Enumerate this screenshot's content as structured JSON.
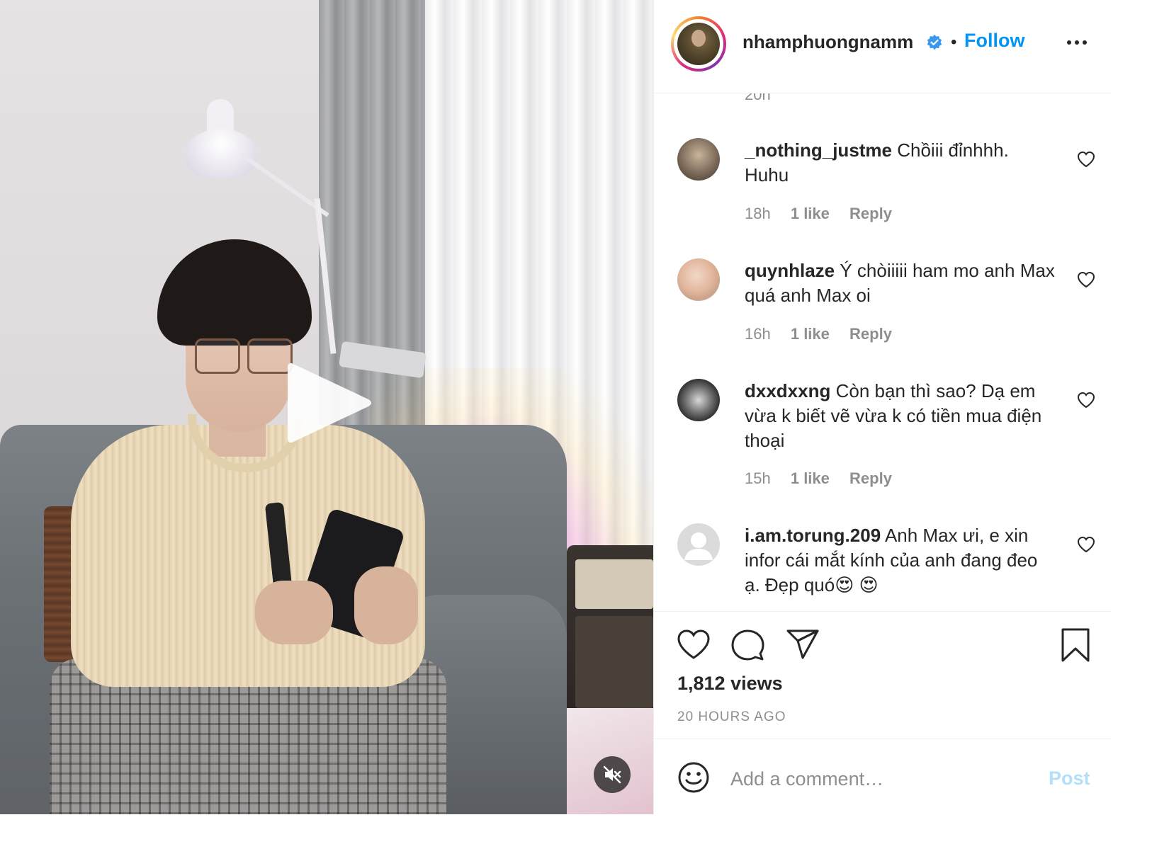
{
  "post": {
    "author": "nhamphuongnamm",
    "verified": true,
    "separator": "•",
    "follow_label": "Follow",
    "views": "1,812 views",
    "posted_ago": "20 HOURS AGO"
  },
  "comments": {
    "truncated_time": "20h",
    "items": [
      {
        "user": "_nothing_justme",
        "text": " Chồiii đỉnhhh. Huhu",
        "time": "18h",
        "likes": "1 like",
        "reply": "Reply"
      },
      {
        "user": "quynhlaze",
        "text": " Ý chòiiiii ham mo anh Max quá anh Max oi",
        "time": "16h",
        "likes": "1 like",
        "reply": "Reply"
      },
      {
        "user": "dxxdxxng",
        "text": " Còn bạn thì sao? Dạ em vừa k biết vẽ vừa k có tiền mua điện thoại",
        "time": "15h",
        "likes": "1 like",
        "reply": "Reply"
      },
      {
        "user": "i.am.torung.209",
        "text": " Anh Max ưi, e xin infor cái mắt kính của anh đang đeo ạ. Đẹp quó😍 😍",
        "time": "",
        "likes": "",
        "reply": ""
      }
    ]
  },
  "add_comment": {
    "placeholder": "Add a comment…",
    "post_label": "Post"
  },
  "colors": {
    "link_blue": "#0095f6",
    "post_disabled": "#b2dffc",
    "muted_text": "#8e8e8e"
  },
  "icons": [
    "verified-badge-icon",
    "more-options-icon",
    "heart-icon",
    "comment-icon",
    "share-icon",
    "bookmark-icon",
    "emoji-icon",
    "play-icon",
    "muted-speaker-icon"
  ]
}
